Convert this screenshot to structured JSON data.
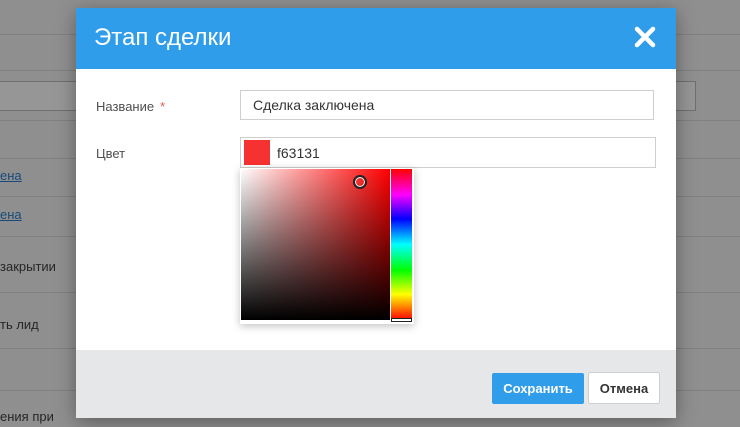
{
  "background": {
    "texts": [
      {
        "text": "ена",
        "link": true
      },
      {
        "text": "ена",
        "link": true
      },
      {
        "text": "закрытии",
        "link": false
      },
      {
        "text": "ть лид",
        "link": false
      },
      {
        "text": "ения при",
        "link": false
      }
    ]
  },
  "modal": {
    "title": "Этап сделки",
    "close_icon": "close-icon",
    "fields": {
      "name_label": "Название",
      "required_mark": "*",
      "name_value": "Сделка заключена",
      "color_label": "Цвет",
      "color_hex": "f63131"
    },
    "colors": {
      "header": "#2f9de9",
      "selected_color": "#f63131",
      "save_button": "#2f9de9",
      "footer": "#e6e7e9"
    },
    "picker": {
      "hue_deg": 0,
      "saturation": 0.8,
      "value": 0.96
    },
    "footer": {
      "save_label": "Сохранить",
      "cancel_label": "Отмена"
    }
  }
}
